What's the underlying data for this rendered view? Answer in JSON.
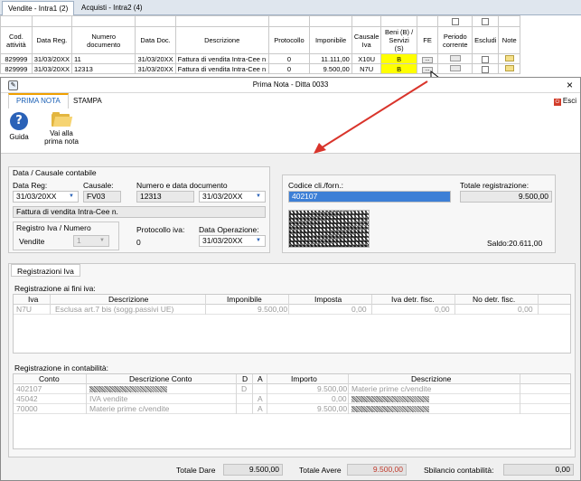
{
  "app": {
    "tabs": [
      "Vendite - Intra1 (2)",
      "Acquisti - Intra2 (4)"
    ],
    "grid": {
      "headers": [
        "Cod. attività",
        "Data Reg.",
        "Numero documento",
        "Data Doc.",
        "Descrizione",
        "Protocollo",
        "Imponibile",
        "Causale Iva",
        "Beni (B) / Servizi (S)",
        "FE",
        "Periodo corrente",
        "Escludi",
        "Note"
      ],
      "rows": [
        {
          "cod": "829999",
          "data_reg": "31/03/20XX",
          "numero": "11",
          "data_doc": "31/03/20XX",
          "descrizione": "Fattura di vendita Intra-Cee n",
          "protocollo": "0",
          "imponibile": "11.111,00",
          "causale": "X10U",
          "beni": "B",
          "fe": "..."
        },
        {
          "cod": "829999",
          "data_reg": "31/03/20XX",
          "numero": "12313",
          "data_doc": "31/03/20XX",
          "descrizione": "Fattura di vendita Intra-Cee n",
          "protocollo": "0",
          "imponibile": "9.500,00",
          "causale": "N7U",
          "beni": "B",
          "fe": "..."
        }
      ]
    }
  },
  "dialog": {
    "title": "Prima Nota - Ditta 0033",
    "close": "×",
    "ribbon_tabs": [
      "PRIMA NOTA",
      "STAMPA"
    ],
    "esci": "Esci",
    "buttons": {
      "guida": "Guida",
      "vai": "Vai alla prima nota"
    },
    "causale_group": {
      "title": "Data / Causale contabile",
      "data_reg_label": "Data Reg:",
      "data_reg": "31/03/20XX",
      "causale_label": "Causale:",
      "causale": "FV03",
      "numero_label": "Numero e data documento",
      "numero": "12313",
      "data_doc": "31/03/20XX",
      "descrizione": "Fattura di vendita Intra-Cee n.",
      "registro_title": "Registro Iva / Numero",
      "registro": "Vendite",
      "registro_num": "1",
      "protocollo_label": "Protocollo iva:",
      "protocollo": "0",
      "data_op_label": "Data Operazione:",
      "data_op": "31/03/20XX"
    },
    "cliente_group": {
      "codice_label": "Codice cli./forn.:",
      "codice": "402107",
      "totale_label": "Totale registrazione:",
      "totale": "9.500,00",
      "saldo_label": "Saldo:",
      "saldo": "20.611,00"
    },
    "registrazioni_tab": "Registrazioni Iva",
    "iva_section": {
      "title": "Registrazione ai fini iva:",
      "headers": [
        "Iva",
        "Descrizione",
        "Imponibile",
        "Imposta",
        "Iva detr. fisc.",
        "No detr. fisc."
      ],
      "rows": [
        {
          "iva": "N7U",
          "descrizione": "Esclusa art.7 bis (sogg.passivi UE)",
          "imponibile": "9.500,00",
          "imposta": "0,00",
          "detr": "0,00",
          "nodetr": "0,00"
        }
      ]
    },
    "contab_section": {
      "title": "Registrazione in contabilità:",
      "headers": [
        "Conto",
        "Descrizione Conto",
        "D",
        "A",
        "Importo",
        "Descrizione"
      ],
      "rows": [
        {
          "conto": "402107",
          "descr_conto": "",
          "d": "D",
          "a": "",
          "importo": "9.500,00",
          "descrizione": "Materie prime c/vendite"
        },
        {
          "conto": "45042",
          "descr_conto": "IVA vendite",
          "d": "",
          "a": "A",
          "importo": "0,00",
          "descrizione": ""
        },
        {
          "conto": "70000",
          "descr_conto": "Materie prime c/vendite",
          "d": "",
          "a": "A",
          "importo": "9.500,00",
          "descrizione": ""
        }
      ]
    },
    "totals": {
      "dare_label": "Totale Dare",
      "dare": "9.500,00",
      "avere_label": "Totale Avere",
      "avere": "9.500,00",
      "sbilancio_label": "Sbilancio contabilità:",
      "sbilancio": "0,00"
    }
  },
  "colors": {
    "accent": "#1a5fb4",
    "highlight": "#ffff00",
    "arrow": "#d9342b",
    "avere_value": "#c0392b"
  }
}
